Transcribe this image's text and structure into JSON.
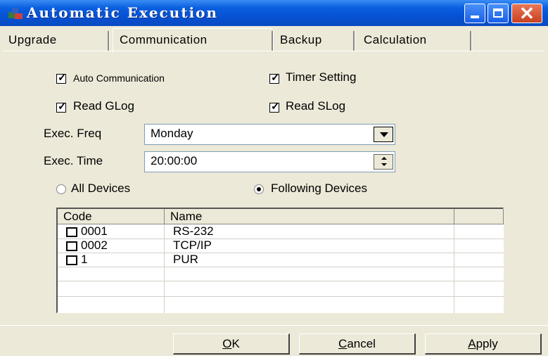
{
  "window": {
    "title": "Automatic Execution",
    "close_glyph": "✕"
  },
  "tabs": [
    {
      "label": "Upgrade",
      "active": false
    },
    {
      "label": "Communication",
      "active": true
    },
    {
      "label": "Backup",
      "active": false
    },
    {
      "label": "Calculation",
      "active": false
    }
  ],
  "options": {
    "auto_communication": {
      "label": "Auto Communication",
      "checked": true
    },
    "timer_setting": {
      "label": "Timer Setting",
      "checked": true
    },
    "read_glog": {
      "label": "Read GLog",
      "checked": true
    },
    "read_slog": {
      "label": "Read SLog",
      "checked": true
    }
  },
  "exec_freq": {
    "label": "Exec. Freq",
    "value": "Monday"
  },
  "exec_time": {
    "label": "Exec. Time",
    "value": "20:00:00"
  },
  "devices_mode": {
    "all_label": "All Devices",
    "following_label": "Following Devices",
    "selected": "following"
  },
  "device_list": {
    "columns": [
      "Code",
      "Name",
      ""
    ],
    "rows": [
      {
        "code": "0001",
        "name": "RS-232",
        "checked": false
      },
      {
        "code": "0002",
        "name": "TCP/IP",
        "checked": false
      },
      {
        "code": "1",
        "name": "PUR",
        "checked": false
      }
    ]
  },
  "buttons": {
    "ok": {
      "label": "OK",
      "access_key": "O",
      "rest": "K"
    },
    "cancel": {
      "label": "Cancel",
      "access_key": "C",
      "rest": "ancel"
    },
    "apply": {
      "label": "Apply",
      "access_key": "A",
      "rest": "pply"
    }
  },
  "colors": {
    "titlebar": "#0a5fe0",
    "face": "#ece9d8",
    "close": "#c84020"
  },
  "icons": [
    "app-icon",
    "minimize-icon",
    "maximize-icon",
    "close-icon",
    "chevron-down-icon",
    "spin-up-icon",
    "spin-down-icon",
    "checkmark-icon"
  ]
}
